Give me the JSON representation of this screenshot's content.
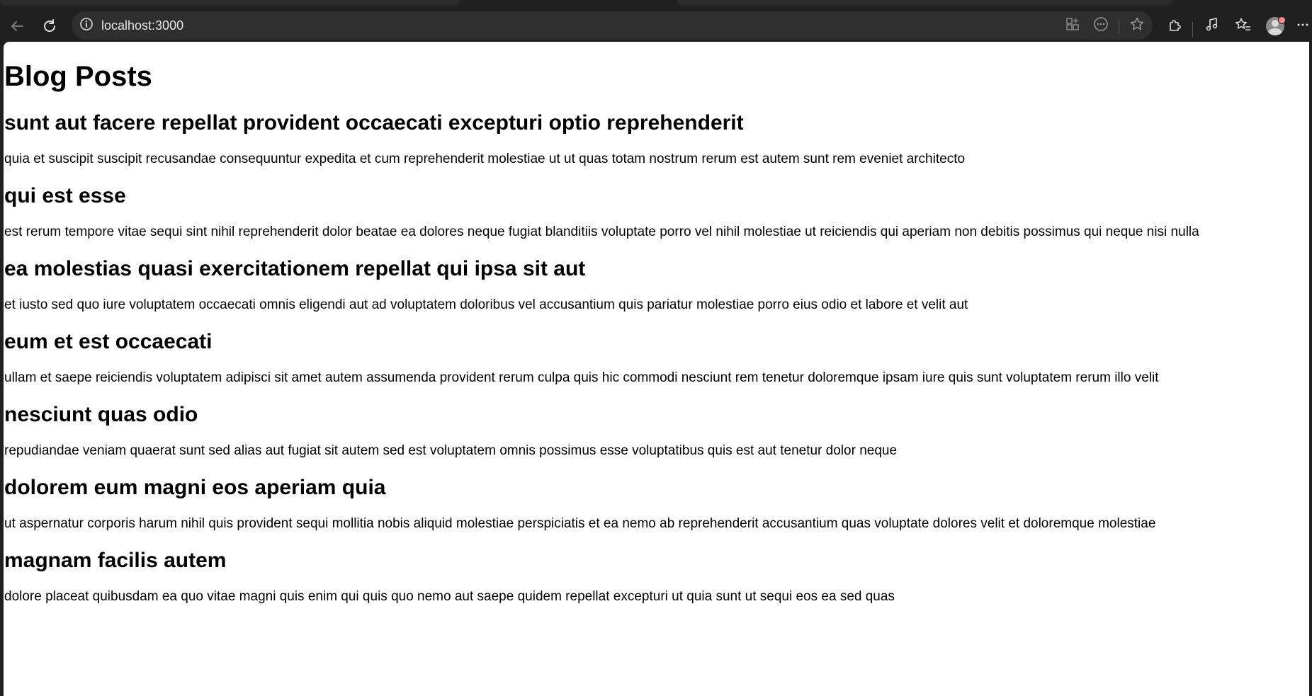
{
  "browser": {
    "url": "localhost:3000"
  },
  "page": {
    "title": "Blog Posts",
    "posts": [
      {
        "title": "sunt aut facere repellat provident occaecati excepturi optio reprehenderit",
        "body": "quia et suscipit suscipit recusandae consequuntur expedita et cum reprehenderit molestiae ut ut quas totam nostrum rerum est autem sunt rem eveniet architecto"
      },
      {
        "title": "qui est esse",
        "body": "est rerum tempore vitae sequi sint nihil reprehenderit dolor beatae ea dolores neque fugiat blanditiis voluptate porro vel nihil molestiae ut reiciendis qui aperiam non debitis possimus qui neque nisi nulla"
      },
      {
        "title": "ea molestias quasi exercitationem repellat qui ipsa sit aut",
        "body": "et iusto sed quo iure voluptatem occaecati omnis eligendi aut ad voluptatem doloribus vel accusantium quis pariatur molestiae porro eius odio et labore et velit aut"
      },
      {
        "title": "eum et est occaecati",
        "body": "ullam et saepe reiciendis voluptatem adipisci sit amet autem assumenda provident rerum culpa quis hic commodi nesciunt rem tenetur doloremque ipsam iure quis sunt voluptatem rerum illo velit"
      },
      {
        "title": "nesciunt quas odio",
        "body": "repudiandae veniam quaerat sunt sed alias aut fugiat sit autem sed est voluptatem omnis possimus esse voluptatibus quis est aut tenetur dolor neque"
      },
      {
        "title": "dolorem eum magni eos aperiam quia",
        "body": "ut aspernatur corporis harum nihil quis provident sequi mollitia nobis aliquid molestiae perspiciatis et ea nemo ab reprehenderit accusantium quas voluptate dolores velit et doloremque molestiae"
      },
      {
        "title": "magnam facilis autem",
        "body": "dolore placeat quibusdam ea quo vitae magni quis enim qui quis quo nemo aut saepe quidem repellat excepturi ut quia sunt ut sequi eos ea sed quas"
      }
    ]
  },
  "icons": {
    "back": "back-arrow-icon",
    "refresh": "refresh-icon",
    "site_info": "info-icon",
    "app_available": "app-grid-icon",
    "more_addr": "ellipsis-circle-icon",
    "favorite": "star-icon",
    "extensions": "puzzle-icon",
    "media": "music-note-icon",
    "favorites_list": "favorites-list-icon",
    "profile": "avatar",
    "menu": "more-horizontal-icon"
  },
  "colors": {
    "browser_chrome": "#202020",
    "address_bar": "#2f2f2f",
    "page_background": "#ffffff",
    "text": "#000000",
    "profile_badge": "#f28b8b"
  }
}
